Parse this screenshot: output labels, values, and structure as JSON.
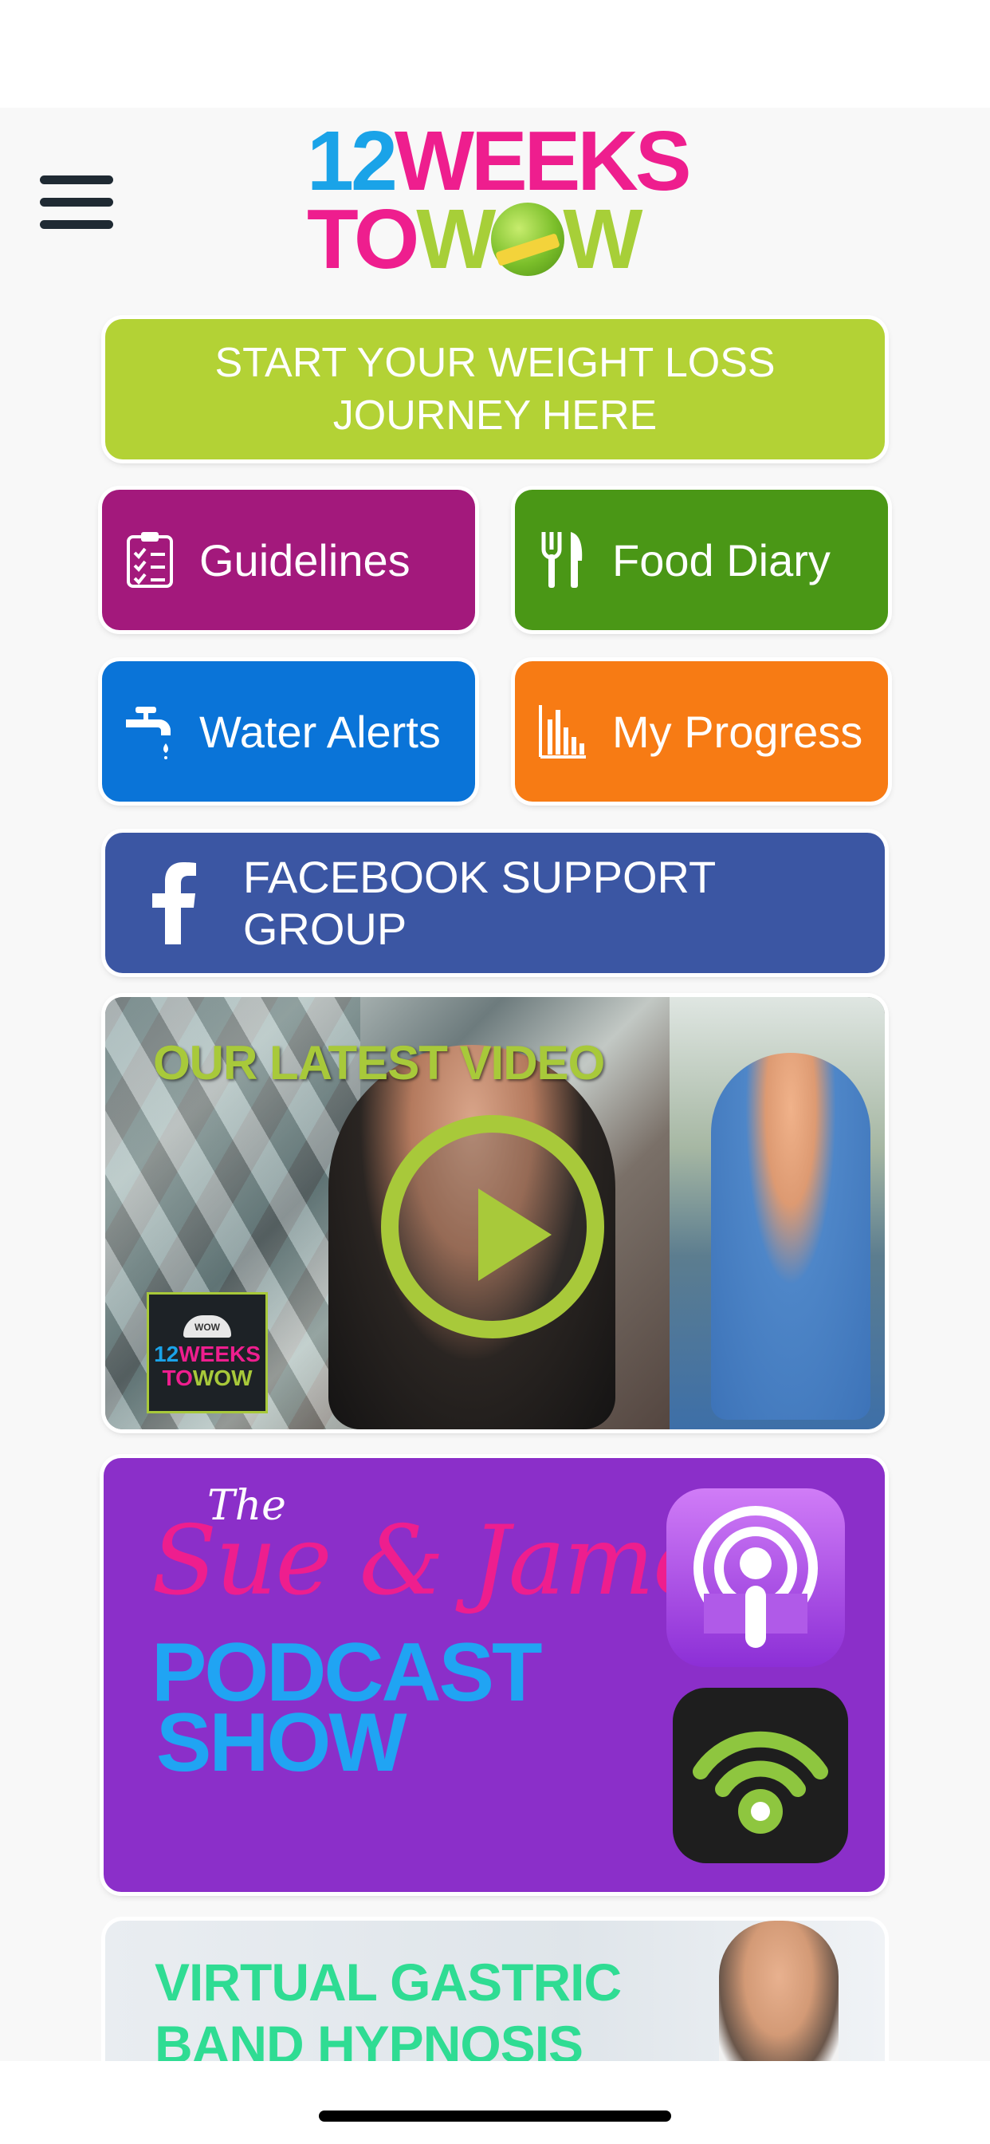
{
  "app": {
    "logo": {
      "line1_num": "12",
      "line1_word": "WEEKS",
      "line2_to": "TO",
      "line2_w1": "W",
      "line2_w2": "W"
    }
  },
  "menu": {
    "icon": "hamburger-menu-icon"
  },
  "start_button": {
    "label": "START YOUR WEIGHT LOSS JOURNEY HERE",
    "color": "#b3d235"
  },
  "tiles": [
    {
      "label": "Guidelines",
      "icon": "clipboard-checklist-icon",
      "color": "#a3197c"
    },
    {
      "label": "Food Diary",
      "icon": "fork-knife-icon",
      "color": "#4a9716"
    },
    {
      "label": "Water Alerts",
      "icon": "water-tap-icon",
      "color": "#0a74d8"
    },
    {
      "label": "My Progress",
      "icon": "bar-chart-icon",
      "color": "#f77b14"
    }
  ],
  "facebook": {
    "label": "FACEBOOK SUPPORT GROUP",
    "icon": "facebook-icon",
    "color": "#3b56a3"
  },
  "video": {
    "title": "OUR LATEST VIDEO",
    "play_icon": "play-icon",
    "mini_logo": {
      "l1_num": "12",
      "l1_word": "WEEKS",
      "l2_to": "TO",
      "l2_wow": "WOW",
      "scale_text": "WOW"
    },
    "accent": "#a8c93a"
  },
  "podcast": {
    "the": "The",
    "names": "Sue & James",
    "line1": "PODCAST",
    "line2": "SHOW",
    "apple_icon": "apple-podcasts-icon",
    "castbox_icon": "podcast-wifi-icon",
    "color": "#8b2fc9"
  },
  "hypnosis": {
    "line1": "VIRTUAL GASTRIC",
    "line2": "BAND HYPNOSIS"
  }
}
